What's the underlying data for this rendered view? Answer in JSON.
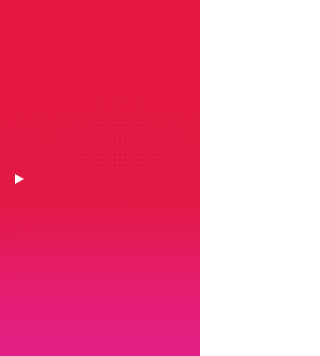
{
  "screen": {
    "background_top": "#e4173f",
    "background_bottom": "#e32087",
    "texture": "dot-pattern"
  },
  "controls": {
    "play_icon": "play-icon",
    "play_icon_color": "#ffffff"
  }
}
